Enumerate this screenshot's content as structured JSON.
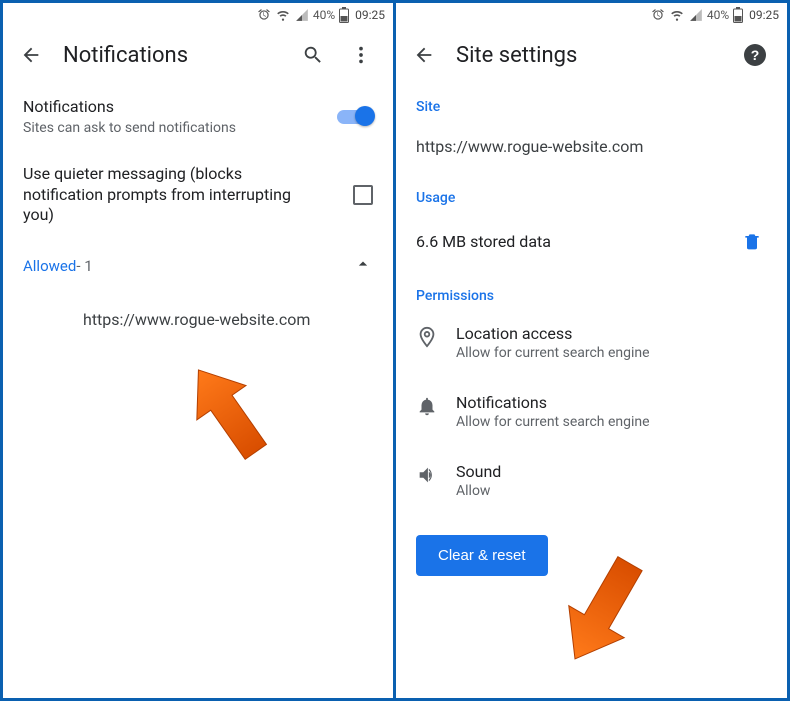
{
  "status": {
    "battery_pct": "40%",
    "time": "09:25"
  },
  "left": {
    "header_title": "Notifications",
    "notif": {
      "title": "Notifications",
      "subtitle": "Sites can ask to send notifications"
    },
    "quieter": {
      "title": "Use quieter messaging (blocks notification prompts from interrupting you)"
    },
    "allowed": {
      "label": "Allowed",
      "count": " - 1"
    },
    "site_url": "https://www.rogue-website.com"
  },
  "right": {
    "header_title": "Site settings",
    "labels": {
      "site": "Site",
      "usage": "Usage",
      "permissions": "Permissions"
    },
    "site_url": "https://www.rogue-website.com",
    "usage_text": "6.6 MB stored data",
    "permissions": {
      "location": {
        "title": "Location access",
        "sub": "Allow for current search engine"
      },
      "notifications": {
        "title": "Notifications",
        "sub": "Allow for current search engine"
      },
      "sound": {
        "title": "Sound",
        "sub": "Allow"
      }
    },
    "clear_button": "Clear & reset"
  }
}
